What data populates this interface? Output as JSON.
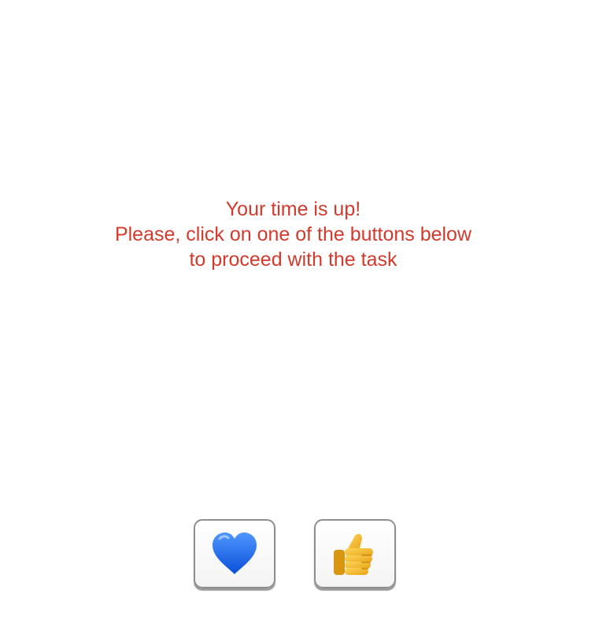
{
  "message": {
    "line1": "Your time is up!",
    "line2": "Please, click on one of the buttons below",
    "line3": "to proceed with the task",
    "color": "#d33a2c"
  },
  "buttons": [
    {
      "icon": "blue-heart-icon",
      "color": "#1f6bf0"
    },
    {
      "icon": "thumbs-up-icon",
      "color": "#f6c23a"
    }
  ]
}
